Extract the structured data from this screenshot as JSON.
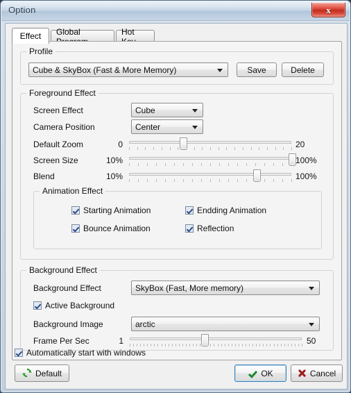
{
  "window": {
    "title": "Option",
    "close_icon": "close-x-icon",
    "close_label": "x"
  },
  "tabs": [
    {
      "label": "Effect",
      "selected": true
    },
    {
      "label": "Global Program",
      "selected": false
    },
    {
      "label": "Hot Key",
      "selected": false
    }
  ],
  "profile": {
    "group_title": "Profile",
    "combo_value": "Cube & SkyBox (Fast & More Memory)",
    "save_label": "Save",
    "delete_label": "Delete"
  },
  "foreground": {
    "group_title": "Foreground Effect",
    "screen_effect_label": "Screen Effect",
    "screen_effect_value": "Cube",
    "camera_position_label": "Camera Position",
    "camera_position_value": "Center",
    "default_zoom_label": "Default Zoom",
    "default_zoom_min": "0",
    "default_zoom_max": "20",
    "default_zoom_percent": 33,
    "screen_size_label": "Screen Size",
    "screen_size_min": "10%",
    "screen_size_max": "100%",
    "screen_size_percent": 100,
    "blend_label": "Blend",
    "blend_min": "10%",
    "blend_max": "100%",
    "blend_percent": 78,
    "animation": {
      "group_title": "Animation Effect",
      "items": [
        {
          "label": "Starting Animation",
          "checked": true
        },
        {
          "label": "Endding Animation",
          "checked": true
        },
        {
          "label": "Bounce Animation",
          "checked": true
        },
        {
          "label": "Reflection",
          "checked": true
        }
      ]
    }
  },
  "background": {
    "group_title": "Background Effect",
    "background_effect_label": "Background Effect",
    "background_effect_value": "SkyBox (Fast, More memory)",
    "active_background_label": "Active Background",
    "active_background_checked": true,
    "background_image_label": "Background Image",
    "background_image_value": "arctic",
    "fps_label": "Frame Per Sec",
    "fps_min": "1",
    "fps_max": "50",
    "fps_percent": 43
  },
  "footer": {
    "autostart_label": "Automatically start with windows",
    "autostart_checked": true,
    "default_label": "Default",
    "default_icon": "refresh-icon",
    "ok_label": "OK",
    "ok_icon": "checkmark-icon",
    "cancel_label": "Cancel",
    "cancel_icon": "x-mark-icon"
  },
  "colors": {
    "accent": "#3c7fb1",
    "close_red": "#c22e1e",
    "ok_green": "#1f8a2e",
    "cancel_red": "#9e1a1a"
  }
}
